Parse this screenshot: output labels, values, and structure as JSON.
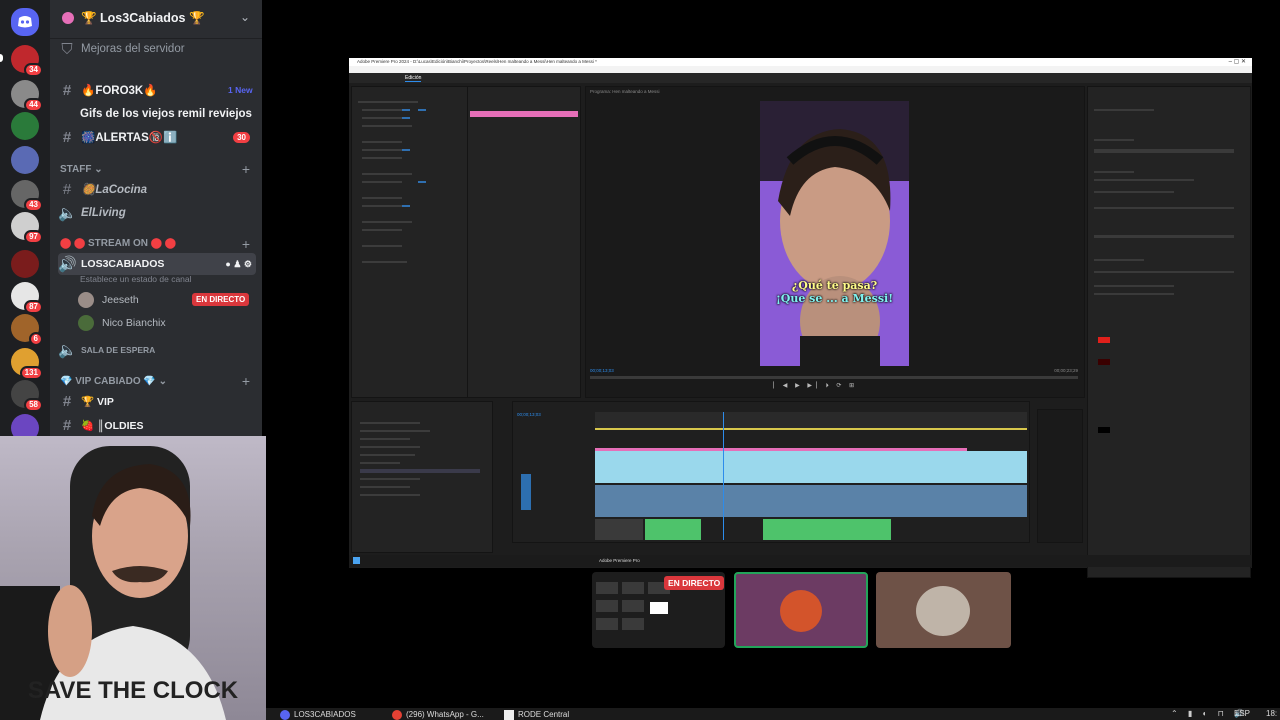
{
  "discord": {
    "server_name": "🏆 Los3Cabiados 🏆",
    "boost_label": "Mejoras del servidor",
    "channels": [
      {
        "name": "🔥FORO3K🔥",
        "badge": "1 New"
      },
      {
        "name": "Gifs de los viejos remil reviejos"
      },
      {
        "name": "🎆ALERTAS🔞ℹ️",
        "badge": "30"
      }
    ],
    "categories": {
      "staff": "STAFF",
      "stream_on": "STREAM ON",
      "vip": "VIP CABIADO"
    },
    "staff_channels": [
      {
        "name": "🥘LaCocina"
      },
      {
        "name": "ElLiving"
      }
    ],
    "voice_channel": {
      "name": "LOS3CABIADOS",
      "status_placeholder": "Establece un estado de canal",
      "users": [
        {
          "name": "Jeeseth",
          "live_label": "EN DIRECTO"
        },
        {
          "name": "Nico Bianchix"
        }
      ]
    },
    "waiting_room": "SALA DE ESPERA",
    "vip_channels": [
      {
        "name": "🏆 VIP"
      },
      {
        "name": "🍓 ║OLDIES"
      }
    ],
    "server_badges": [
      "34",
      "44",
      "43",
      "97",
      "87",
      "6",
      "131",
      "58"
    ]
  },
  "premiere": {
    "title": "Adobe Premiere Pro 2024 - D:\\Lucas\\Edición\\Bianchi\\Proyectos\\Reels\\Hen malteando a Messi\\Hen malteando a Messi *",
    "program_title": "Programa: Hen malteando a Messi",
    "subtitle_line1": "¿Qué te pasa?",
    "subtitle_line2": "¡Que se ... a Messi!",
    "tab_edit": "Edición",
    "timecode": "00;00;13;03",
    "end_timecode": "00;00;23;29"
  },
  "stream": {
    "live_label": "EN DIRECTO"
  },
  "win_taskbar": {
    "items": [
      "LOS3CABIADOS",
      "(296) WhatsApp - G...",
      "RODE Central"
    ],
    "lang": "ESP",
    "time": "18:"
  },
  "colors": {
    "discord_bg": "#2b2d31",
    "rail_bg": "#1e1f22",
    "live_red": "#da373c",
    "clip_blue": "#9ad8ec",
    "clip_green": "#4ec36b",
    "clip_pink": "#e66fb8"
  }
}
